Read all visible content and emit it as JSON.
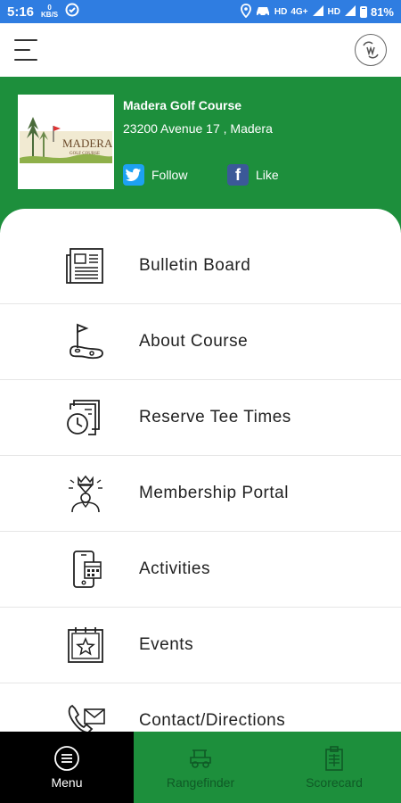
{
  "status_bar": {
    "time": "5:16",
    "data_rate_value": "0",
    "data_rate_unit": "KB/S",
    "network_left": "HD",
    "network_type": "4G+",
    "network_right": "HD",
    "battery": "81%"
  },
  "course": {
    "name": "Madera Golf Course",
    "address": "23200 Avenue 17 , Madera",
    "logo_title": "MADERA",
    "logo_subtitle": "GOLF COURSE"
  },
  "social": {
    "follow_label": "Follow",
    "like_label": "Like"
  },
  "menu": {
    "items": [
      {
        "label": "Bulletin Board",
        "icon": "newspaper-icon"
      },
      {
        "label": "About Course",
        "icon": "golf-flag-icon"
      },
      {
        "label": "Reserve Tee Times",
        "icon": "clock-document-icon"
      },
      {
        "label": "Membership Portal",
        "icon": "member-crown-icon"
      },
      {
        "label": "Activities",
        "icon": "phone-calendar-icon"
      },
      {
        "label": "Events",
        "icon": "calendar-star-icon"
      },
      {
        "label": "Contact/Directions",
        "icon": "phone-mail-icon"
      }
    ]
  },
  "bottom_nav": {
    "tabs": [
      {
        "label": "Menu",
        "icon": "menu-circle-icon",
        "active": true
      },
      {
        "label": "Rangefinder",
        "icon": "golf-cart-icon",
        "active": false
      },
      {
        "label": "Scorecard",
        "icon": "clipboard-icon",
        "active": false
      }
    ]
  },
  "colors": {
    "status_bar": "#2f7de1",
    "brand_green": "#1d8f3c",
    "nav_active": "#000000",
    "twitter": "#1da1f2",
    "facebook": "#3b5998"
  }
}
